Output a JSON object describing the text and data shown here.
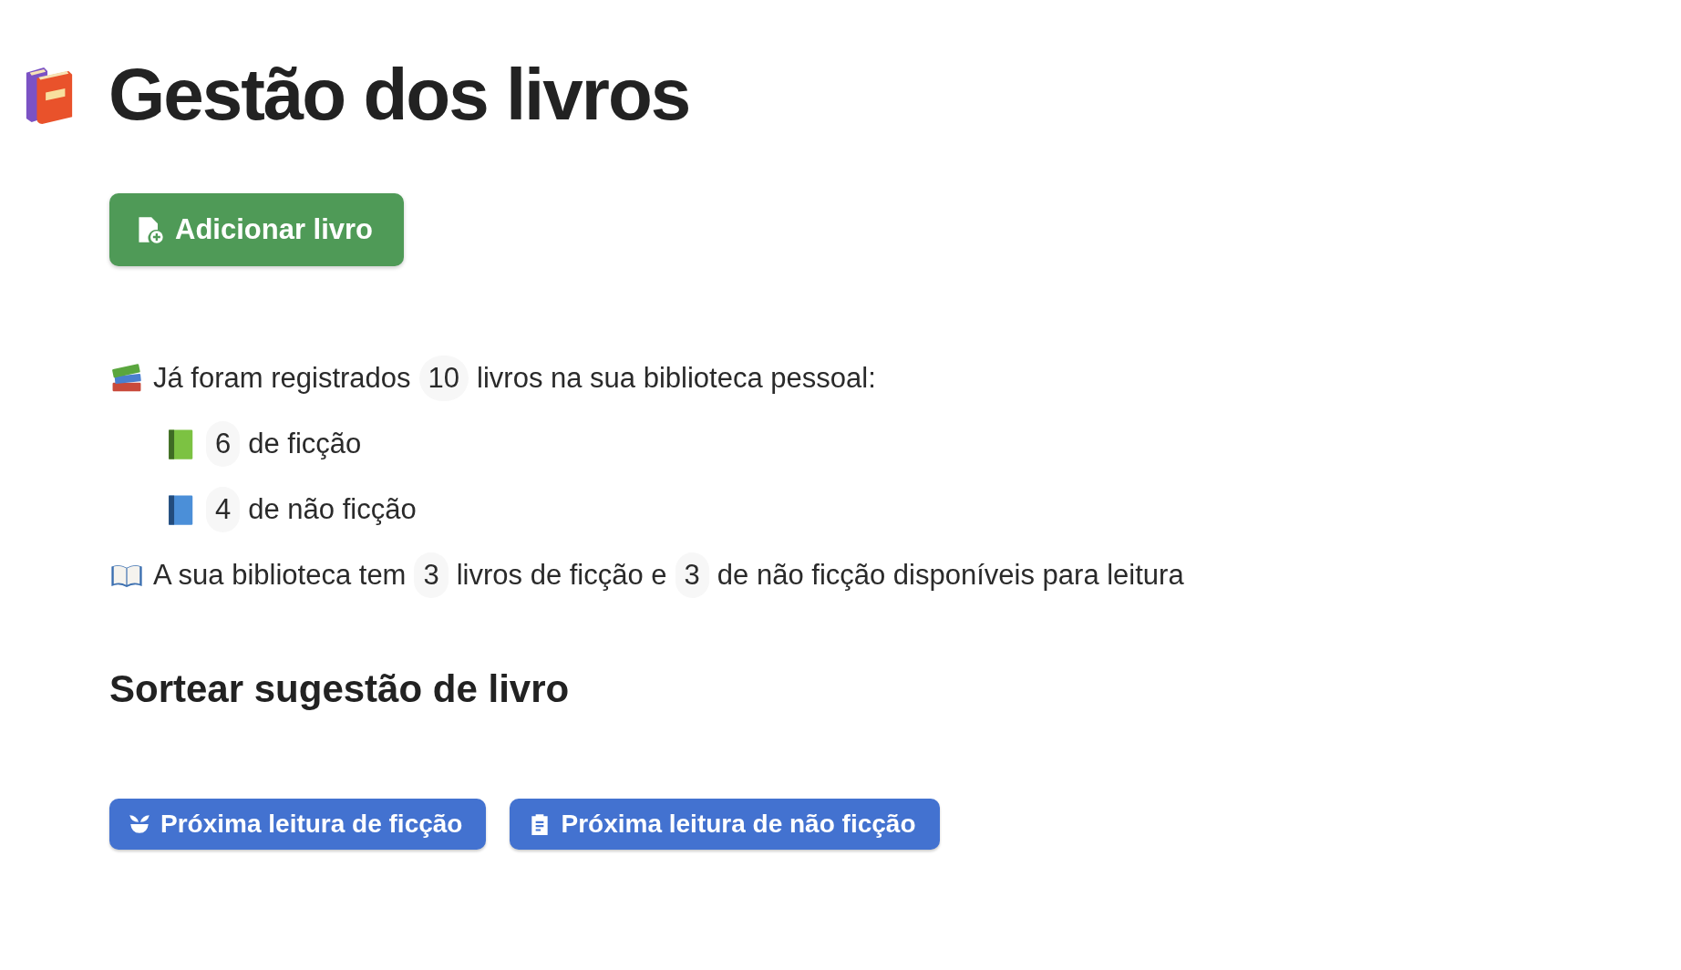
{
  "title": "Gestão dos livros",
  "add_button": {
    "label": "Adicionar livro"
  },
  "summary": [
    {
      "kind": "books",
      "parts": [
        {
          "kind": "text",
          "text": "Já foram registrados"
        },
        {
          "kind": "count",
          "text": "10"
        },
        {
          "kind": "text",
          "text": "livros na sua biblioteca pessoal:"
        }
      ],
      "children": [
        {
          "kind": "green-book",
          "parts": [
            {
              "kind": "count",
              "text": "6"
            },
            {
              "kind": "text",
              "text": "de ficção"
            }
          ]
        },
        {
          "kind": "blue-book",
          "parts": [
            {
              "kind": "count",
              "text": "4"
            },
            {
              "kind": "text",
              "text": "de não ficção"
            }
          ]
        }
      ]
    },
    {
      "kind": "open-book",
      "parts": [
        {
          "kind": "text",
          "text": "A sua biblioteca tem"
        },
        {
          "kind": "count",
          "text": "3"
        },
        {
          "kind": "text",
          "text": "livros de ficção e"
        },
        {
          "kind": "count",
          "text": "3"
        },
        {
          "kind": "text",
          "text": "de não ficção disponíveis para leitura"
        }
      ]
    }
  ],
  "section_title": "Sortear sugestão de livro",
  "actions": [
    {
      "kind": "sprout",
      "label": "Próxima leitura de ficção"
    },
    {
      "kind": "clipboard",
      "label": "Próxima leitura de não ficção"
    }
  ]
}
